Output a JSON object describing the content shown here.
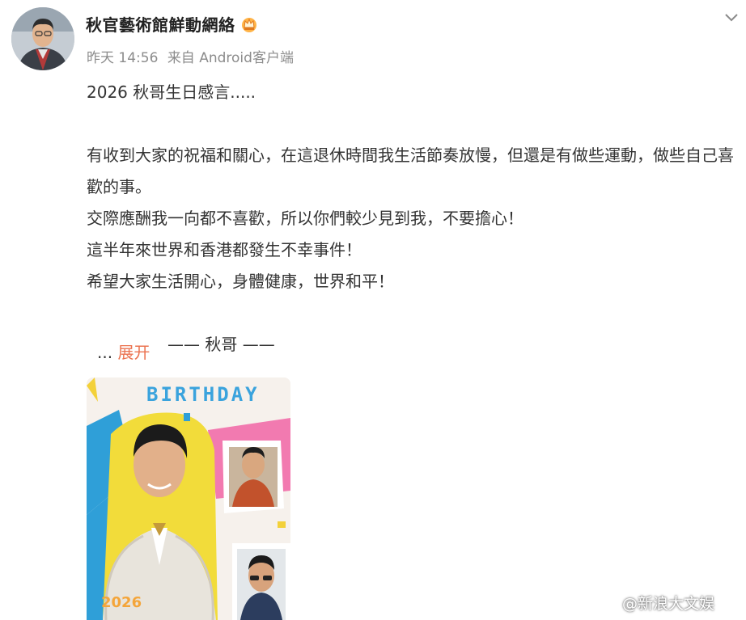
{
  "post": {
    "author": "秋官藝術館鮮動網絡",
    "time": "昨天 14:56",
    "source": "来自 Android客户端",
    "lines": [
      "2026 秋哥生日感言.....",
      "",
      "有收到大家的祝福和關心，在這退休時間我生活節奏放慢，但還是有做些運動，做些自己喜歡的事。",
      "交際應酬我一向都不喜歡，所以你們較少見到我，不要擔心！",
      "這半年來世界和香港都發生不幸事件！",
      "希望大家生活開心，身體健康，世界和平！",
      "",
      "——   秋哥 ——"
    ],
    "ellipsis": "...",
    "expand_label": "展开",
    "image": {
      "title": "BIRTHDAY",
      "year": "2026"
    }
  },
  "watermark": "@新浪大文娱",
  "icons": {
    "menu": "chevron-down-icon",
    "badge": "crown-icon",
    "logo": "weibo-icon"
  },
  "colors": {
    "expand": "#eb7350",
    "meta": "#8c8c8c",
    "title_blue": "#3aa3dd"
  }
}
